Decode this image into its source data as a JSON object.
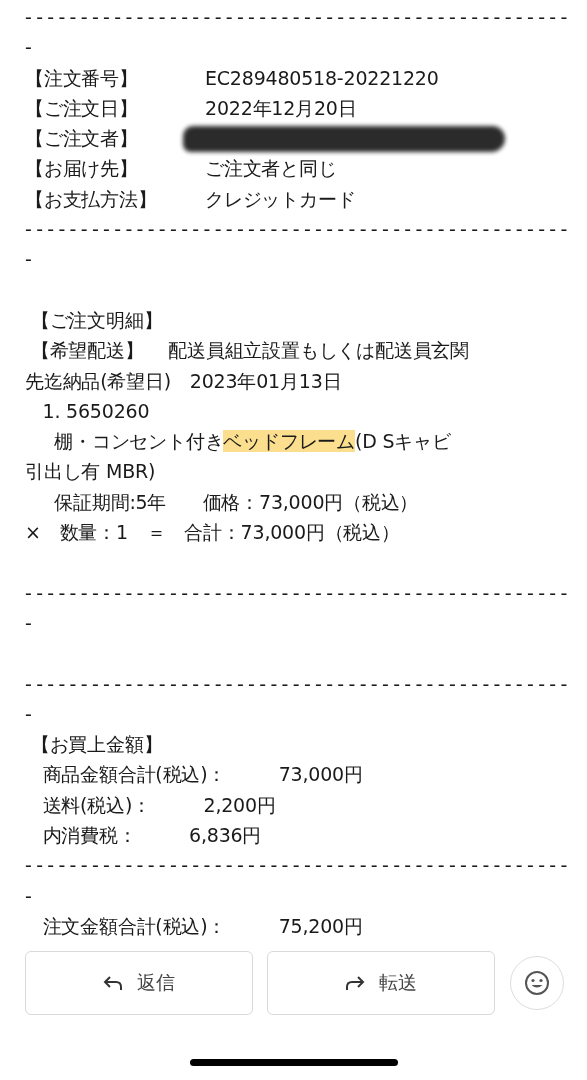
{
  "lines": [
    {
      "kind": "rule",
      "text": "-------------------------------------------------"
    },
    {
      "kind": "text",
      "text": "-"
    },
    {
      "kind": "field",
      "label": "【注文番号】",
      "value": "EC289480518-20221220"
    },
    {
      "kind": "field",
      "label": "【ご注文日】",
      "value": "2022年12月20日"
    },
    {
      "kind": "field",
      "label": "【ご注文者】",
      "redacted": true
    },
    {
      "kind": "field",
      "label": "【お届け先】",
      "value": "ご注文者と同じ"
    },
    {
      "kind": "field",
      "label": "【お支払方法】",
      "value": "クレジットカード"
    },
    {
      "kind": "rule",
      "text": "-------------------------------------------------"
    },
    {
      "kind": "text",
      "text": "-"
    },
    {
      "kind": "blank"
    },
    {
      "kind": "text",
      "text": " 【ご注文明細】"
    },
    {
      "kind": "text",
      "text": " 【希望配送】　 配送員組立設置もしくは配送員玄関"
    },
    {
      "kind": "text",
      "text": "先迄納品(希望日)　2023年01月13日"
    },
    {
      "kind": "text",
      "text": "   1. 5650260"
    },
    {
      "kind": "parts",
      "parts": [
        {
          "text": "     棚・コンセント付き",
          "highlighted": false
        },
        {
          "text": "ベッドフレーム",
          "highlighted": true
        },
        {
          "text": "(D Sキャビ",
          "highlighted": false
        }
      ]
    },
    {
      "kind": "text",
      "text": "引出し有 MBR)"
    },
    {
      "kind": "text",
      "text": "     保証期間:5年　   価格：73,000円（税込）"
    },
    {
      "kind": "text",
      "text": "×　数量：1　＝　合計：73,000円（税込）"
    },
    {
      "kind": "blank"
    },
    {
      "kind": "rule",
      "text": "-------------------------------------------------"
    },
    {
      "kind": "text",
      "text": "-"
    },
    {
      "kind": "blank"
    },
    {
      "kind": "rule",
      "text": "-------------------------------------------------"
    },
    {
      "kind": "text",
      "text": "-"
    },
    {
      "kind": "text",
      "text": " 【お買上金額】"
    },
    {
      "kind": "text",
      "text": "   商品金額合計(税込)：         73,000円"
    },
    {
      "kind": "text",
      "text": "   送料(税込)：         2,200円"
    },
    {
      "kind": "text",
      "text": "   内消費税：         6,836円"
    },
    {
      "kind": "rule",
      "text": "-------------------------------------------------"
    },
    {
      "kind": "text",
      "text": "-"
    },
    {
      "kind": "text",
      "text": "   注文金額合計(税込)：         75,200円"
    }
  ],
  "actions": [
    {
      "kind": "reply",
      "label": "返信"
    },
    {
      "kind": "forward",
      "label": "転送"
    }
  ]
}
